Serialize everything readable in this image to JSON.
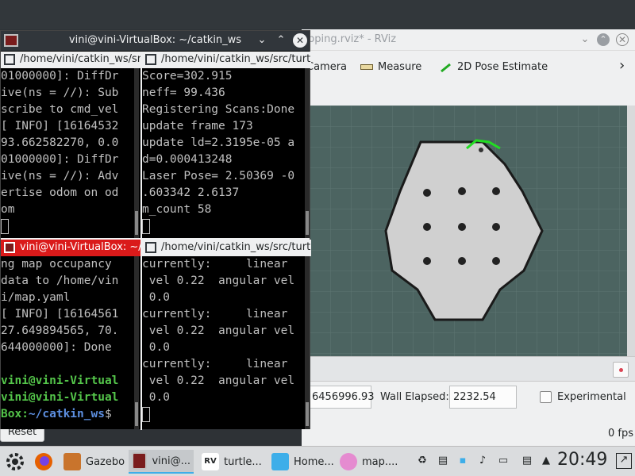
{
  "rviz": {
    "title": "pping.rviz* - RViz",
    "tools": {
      "camera": "Camera",
      "measure": "Measure",
      "pose": "2D Pose Estimate"
    },
    "time": {
      "ros_elapsed_value": "6456996.93",
      "wall_elapsed_label": "Wall Elapsed:",
      "wall_elapsed_value": "2232.54",
      "experimental_label": "Experimental"
    },
    "reset_label": "Reset",
    "fps": "0 fps"
  },
  "terminal": {
    "title": "vini@vini-VirtualBox: ~/catkin_ws",
    "panes": [
      {
        "tab": "/home/vini/catkin_ws/src",
        "active": false,
        "lines": [
          "01000000]: DiffDr",
          "ive(ns = //): Sub",
          "scribe to cmd_vel",
          "[ INFO] [16164532",
          "93.662582270, 0.0",
          "01000000]: DiffDr",
          "ive(ns = //): Adv",
          "ertise odom on od",
          "om"
        ]
      },
      {
        "tab": "/home/vini/catkin_ws/src/turtle",
        "active": false,
        "lines": [
          "Score=302.915",
          "neff= 99.436",
          "Registering Scans:Done",
          "update frame 173",
          "update ld=2.3195e-05 a",
          "d=0.000413248",
          "Laser Pose= 2.50369 -0",
          ".603342 2.6137",
          "m_count 58"
        ]
      },
      {
        "tab": "vini@vini-VirtualBox: ~/ca",
        "active": true,
        "lines": [
          "ng map occupancy",
          "data to /home/vin",
          "i/map.yaml",
          "[ INFO] [16164561",
          "27.649894565, 70.",
          "644000000]: Done",
          ""
        ],
        "prompt_user": "vini@vini-Virtual",
        "prompt_user2": "vini@vini-Virtual",
        "prompt_host_tail": "Box:",
        "prompt_path": "~/catkin_ws",
        "prompt_symbol": "$"
      },
      {
        "tab": "/home/vini/catkin_ws/src/turtle",
        "active": false,
        "lines": [
          "currently:     linear",
          " vel 0.22  angular vel",
          " 0.0",
          "currently:     linear",
          " vel 0.22  angular vel",
          " 0.0",
          "currently:     linear",
          " vel 0.22  angular vel",
          " 0.0"
        ]
      }
    ]
  },
  "taskbar": {
    "tasks": [
      {
        "label": "Gazebo",
        "icon": "gazebo-icon",
        "color": "#c9742c"
      },
      {
        "label": "vini@...",
        "icon": "terminal-icon",
        "color": "#7a1c1c"
      },
      {
        "label": "turtle...",
        "icon": "rviz-icon",
        "color": "#ffffff"
      },
      {
        "label": "Home...",
        "icon": "folder-icon",
        "color": "#3daee9"
      },
      {
        "label": "map....",
        "icon": "image-viewer-icon",
        "color": "#e58bd0"
      }
    ],
    "clock": "20:49"
  },
  "colors": {
    "accent": "#3daee9",
    "map_free": "#d0d0d0",
    "map_wall": "#1a1a1a",
    "map_bg": "#4c6461",
    "laser": "#22dd22",
    "terminal_active_tab": "#da1a1a"
  }
}
